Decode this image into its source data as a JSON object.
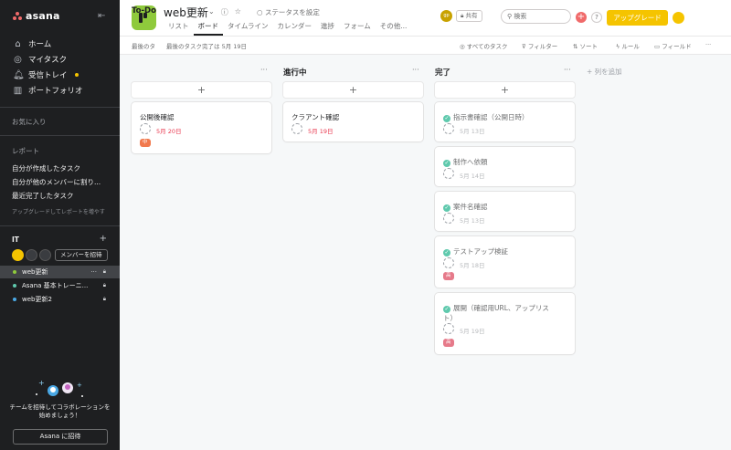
{
  "sidebar": {
    "logo": "asana",
    "nav": [
      {
        "label": "ホーム",
        "icon": "home-icon"
      },
      {
        "label": "マイタスク",
        "icon": "check-circle-icon"
      },
      {
        "label": "受信トレイ",
        "icon": "bell-icon"
      },
      {
        "label": "ポートフォリオ",
        "icon": "chart-icon"
      }
    ],
    "favorites_title": "お気に入り",
    "reports_title": "レポート",
    "reports": [
      "自分が作成したタスク",
      "自分が他のメンバーに割り...",
      "最近完了したタスク"
    ],
    "upgrade_note": "アップグレードしてレポートを増やす",
    "team": {
      "name": "IT",
      "invite_members": "メンバーを招待"
    },
    "projects": [
      {
        "name": "web更新",
        "color": "#8fca3c",
        "active": true
      },
      {
        "name": "Asana 基本トレーニ...",
        "color": "#5fc9ad",
        "active": false
      },
      {
        "name": "web更新2",
        "color": "#4aa8e5",
        "active": false
      }
    ],
    "invite": {
      "text_line1": "チームを招待してコラボレーションを",
      "text_line2": "始めましょう！",
      "button": "Asana に招待"
    }
  },
  "topbar": {
    "project_title": "web更新",
    "status": "ステータスを設定",
    "tabs": [
      "リスト",
      "ボード",
      "タイムライン",
      "カレンダー",
      "進捗",
      "フォーム",
      "その他..."
    ],
    "active_tab": 1,
    "avatar_initials": "gp",
    "share": "共有",
    "search_placeholder": "検索",
    "upgrade": "アップグレード"
  },
  "subbar": {
    "last_task": "最後のタ",
    "last_completed": "最後のタスク完了は 5月 19日",
    "all_tasks": "すべてのタスク",
    "filter": "フィルター",
    "sort": "ソート",
    "rules": "ルール",
    "fields": "フィールド"
  },
  "board": {
    "add_column": "+ 列を追加",
    "columns": [
      {
        "title": "To-Do",
        "cards": [
          {
            "title": "公開後確認",
            "date": "5月 20日",
            "tag": "中",
            "tag_color": "#f1794d",
            "done": false
          }
        ]
      },
      {
        "title": "進行中",
        "cards": [
          {
            "title": "クラアント確認",
            "date": "5月 19日",
            "tag": "",
            "done": false
          }
        ]
      },
      {
        "title": "完了",
        "cards": [
          {
            "title": "指示書確認（公開日時）",
            "date": "5月 13日",
            "tag": "",
            "done": true
          },
          {
            "title": "制作へ依頼",
            "date": "5月 14日",
            "tag": "",
            "done": true
          },
          {
            "title": "案件名確認",
            "date": "5月 13日",
            "tag": "",
            "done": true
          },
          {
            "title": "テストアップ検証",
            "date": "5月 18日",
            "tag": "高",
            "tag_color": "#e67a8a",
            "done": true
          },
          {
            "title_line1": "展開（確認用URL、アップリス",
            "title_line2": "ト）",
            "date": "5月 19日",
            "tag": "高",
            "tag_color": "#e67a8a",
            "done": true
          }
        ]
      }
    ]
  }
}
